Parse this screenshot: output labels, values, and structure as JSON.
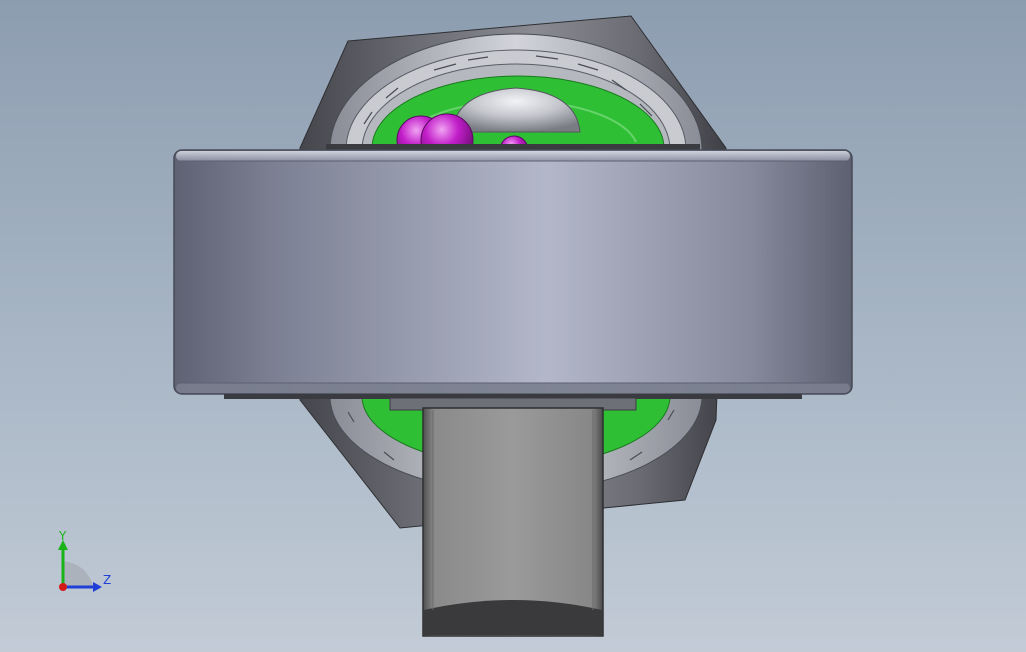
{
  "scene": {
    "colors": {
      "housing": "#5e5f66",
      "band": "#9aa0b4",
      "shaft": "#8c8c8c",
      "raceway_green": "#2fbf35",
      "balls_magenta": "#c21ec9",
      "hub_silver": "#c4c6cc"
    }
  },
  "triad": {
    "y_label": "Y",
    "z_label": "Z",
    "colors": {
      "y_axis": "#19b319",
      "z_axis": "#1f3fd6",
      "origin": "#d41919"
    }
  }
}
